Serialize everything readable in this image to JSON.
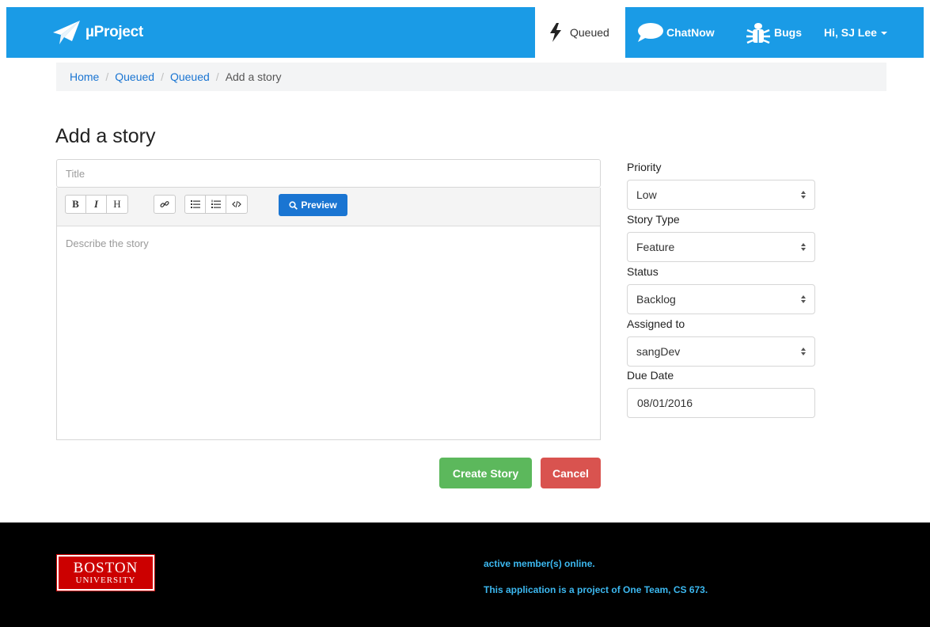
{
  "nav": {
    "brand": "µProject",
    "queued": "Queued",
    "chatnow": "ChatNow",
    "bugs": "Bugs",
    "user": "Hi, SJ Lee"
  },
  "breadcrumb": {
    "home": "Home",
    "queued1": "Queued",
    "queued2": "Queued",
    "current": "Add a story",
    "sep": "/"
  },
  "page": {
    "title": "Add a story"
  },
  "editor": {
    "title_placeholder": "Title",
    "description_placeholder": "Describe the story",
    "toolbar": {
      "bold": "B",
      "italic": "I",
      "heading": "H",
      "preview": "Preview"
    }
  },
  "actions": {
    "create": "Create Story",
    "cancel": "Cancel"
  },
  "form": {
    "priority_label": "Priority",
    "priority_value": "Low",
    "story_type_label": "Story Type",
    "story_type_value": "Feature",
    "status_label": "Status",
    "status_value": "Backlog",
    "assigned_label": "Assigned to",
    "assigned_value": "sangDev",
    "due_label": "Due Date",
    "due_value": "08/01/2016"
  },
  "footer": {
    "logo_line1": "BOSTON",
    "logo_line2": "UNIVERSITY",
    "online": "active member(s) online.",
    "about": "This application is a project of One Team, CS 673."
  },
  "colors": {
    "navbar": "#1a9be6",
    "link": "#1a75d2",
    "create": "#5cb85c",
    "cancel": "#d9534f",
    "footer_text": "#3cb8f0",
    "logo": "#cc0000"
  },
  "icons": {
    "brand": "paper-plane-icon",
    "queued": "lightning-bolt-icon",
    "chatnow": "chat-bubble-icon",
    "bugs": "bug-icon",
    "user": "caret-down-icon"
  }
}
